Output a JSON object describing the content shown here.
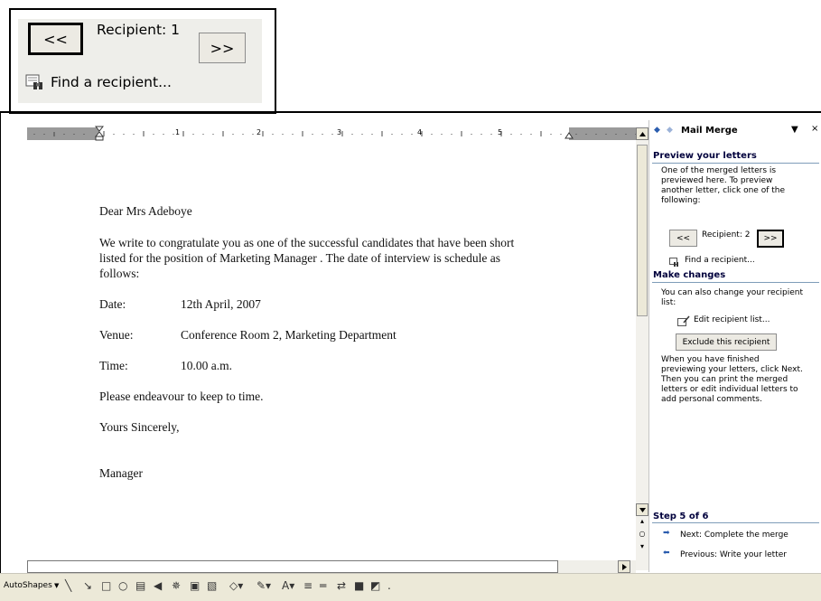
{
  "callout": {
    "prev_label": "<<",
    "recipient_label": "Recipient: 1",
    "next_label": ">>",
    "find_label": "Find a recipient..."
  },
  "ruler": {
    "numbers": [
      "1",
      "2",
      "3",
      "4",
      "5"
    ]
  },
  "letter": {
    "salutation": "Dear Mrs Adeboye",
    "body_line1": "We write to congratulate you as one of the successful candidates that have been short",
    "body_line2": "listed for the position of  Marketing Manager . The date of interview is schedule as",
    "body_line3": "follows:",
    "date_label": "Date:",
    "date_value": "12th April, 2007",
    "venue_label": "Venue:",
    "venue_value": "Conference Room 2, Marketing Department",
    "time_label": "Time:",
    "time_value": "10.00 a.m.",
    "closing_note": "Please endeavour to keep to time.",
    "sign_off": "Yours Sincerely,",
    "signature": "Manager"
  },
  "task_pane": {
    "title": "Mail Merge",
    "preview_heading": "Preview your letters",
    "preview_text1": "One of the merged letters is",
    "preview_text2": "previewed here. To preview",
    "preview_text3": "another letter, click one of the",
    "preview_text4": "following:",
    "prev_label": "<<",
    "recipient_label": "Recipient: 2",
    "next_label": ">>",
    "find_label": "Find a recipient...",
    "changes_heading": "Make changes",
    "changes_text1": "You can also change your recipient",
    "changes_text2": "list:",
    "edit_list_label": "Edit recipient list...",
    "exclude_label": "Exclude this recipient",
    "finish_text1": "When you have finished",
    "finish_text2": "previewing your letters, click Next.",
    "finish_text3": "Then you can print the merged",
    "finish_text4": "letters or edit individual letters to",
    "finish_text5": "add personal comments.",
    "step_label": "Step 5 of 6",
    "next_step_label": "Next: Complete the merge",
    "previous_step_label": "Previous: Write your letter"
  },
  "drawing_toolbar": {
    "autoshapes_label": "AutoShapes"
  },
  "colors": {
    "pane_heading": "#00003c",
    "toolbar_bg": "#ece9d8",
    "ruler_margin": "#9a9a9a"
  }
}
